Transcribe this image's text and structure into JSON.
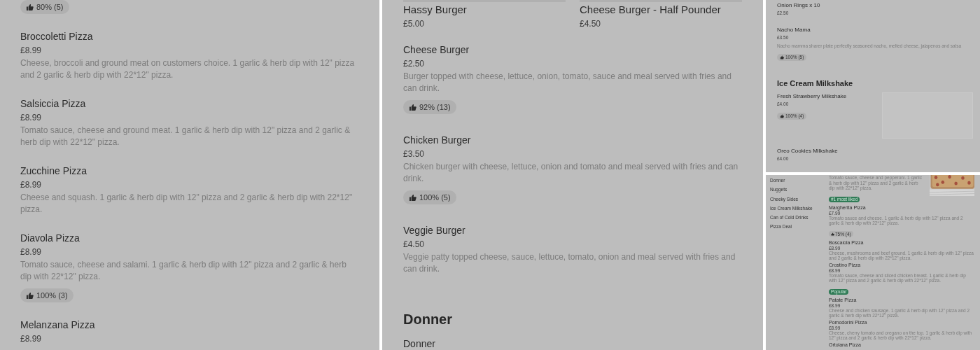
{
  "panels": [
    {
      "blocks": [
        {
          "kind": "rating",
          "text": "80% (5)"
        },
        {
          "kind": "item",
          "name": "Broccoletti Pizza",
          "price": "£8.99",
          "description": "Cheese, broccoli and ground meat on customers choice. 1 garlic & herb dip with 12\" pizza and 2 garlic & herb dip with 22*12\" pizza."
        },
        {
          "kind": "item",
          "name": "Salsiccia Pizza",
          "price": "£8.99",
          "description": "Tomato sauce, cheese and ground meat. 1 garlic & herb dip with 12\" pizza and 2 garlic & herb dip with 22*12\" pizza."
        },
        {
          "kind": "item",
          "name": "Zucchine Pizza",
          "price": "£8.99",
          "description": "Cheese and squash. 1 garlic & herb dip with 12\" pizza and 2 garlic & herb dip with 22*12\" pizza."
        },
        {
          "kind": "item",
          "name": "Diavola Pizza",
          "price": "£8.99",
          "description": "Tomato sauce, cheese and salami. 1 garlic & herb dip with 12\" pizza and 2 garlic & herb dip with 22*12\" pizza.",
          "rating": "100% (3)"
        },
        {
          "kind": "item",
          "name": "Melanzana Pizza",
          "price": "£8.99"
        }
      ]
    },
    {
      "blocks": [
        {
          "kind": "cards",
          "cards": [
            {
              "name": "Hassy Burger",
              "price": "£5.00"
            },
            {
              "name": "Cheese Burger - Half Pounder",
              "price": "£4.50"
            }
          ]
        },
        {
          "kind": "item",
          "name": "Cheese Burger",
          "price": "£2.50",
          "description": "Burger topped with cheese, lettuce, onion, tomato, sauce and meal served with fries and can drink.",
          "rating": "92% (13)"
        },
        {
          "kind": "item",
          "name": "Chicken Burger",
          "price": "£3.50",
          "description": "Chicken burger with cheese, lettuce, onion and tomato and meal served with fries and can drink.",
          "rating": "100% (5)"
        },
        {
          "kind": "item",
          "name": "Veggie Burger",
          "price": "£4.50",
          "description": "Veggie patty topped cheese, sauce, lettuce, tomato, onion and meal served with fries and can drink."
        },
        {
          "kind": "heading",
          "text": "Donner"
        },
        {
          "kind": "item",
          "name": "Donner"
        }
      ]
    },
    {
      "blocks": [
        {
          "kind": "item",
          "name": "Onion Rings x 10",
          "price": "£2.50"
        },
        {
          "kind": "item",
          "name": "Nacho Mama",
          "price": "£3.50",
          "description": "Nacho mamma sharer plate perfectly seasoned nacho, melted cheese, jalapenos and salsa",
          "rating": "100% (5)"
        },
        {
          "kind": "heading",
          "text": "Ice Cream Milkshake"
        },
        {
          "kind": "placeholder-item",
          "name": "Fresh Strawberry Milkshake",
          "price": "£4.00",
          "rating": "100% (4)"
        },
        {
          "kind": "item",
          "name": "Oreo Cookies Milkshake",
          "price": "£4.00"
        }
      ]
    },
    {
      "sidebar": {
        "items": [
          {
            "label": "Donner"
          },
          {
            "label": "Nuggets"
          },
          {
            "label": "Cheeky Sides"
          },
          {
            "label": "Ice Cream Milkshake"
          },
          {
            "label": "Can of Cold Drinks"
          },
          {
            "label": "Pizza Deal"
          }
        ]
      },
      "blocks": [
        {
          "kind": "picture-item",
          "description": "Tomato sauce, cheese and pepperoni. 1 garlic & herb dip with 12\" pizza and 2 garlic & herb dip with 22*12\" pizza.",
          "tag": "#1 most liked"
        },
        {
          "kind": "item",
          "name": "Margherita Pizza",
          "price": "£7.99",
          "description": "Tomato sauce and cheese. 1 garlic & herb dip with 12\" pizza and 2 garlic & herb dip with 22*12\" pizza.",
          "rating": "75% (4)"
        },
        {
          "kind": "item",
          "name": "Boscaiola Pizza",
          "price": "£8.99",
          "description": "Cheese, mushrooms and beef ground. 1 garlic & herb dip with 12\" pizza and 2 garlic & herb dip with 22*12\" pizza."
        },
        {
          "kind": "item",
          "name": "Crostino Pizza",
          "price": "£8.99",
          "description": "Tomato sauce, cheese and sliced chicken breast. 1 garlic & herb dip with 12\" pizza and 2 garlic & herb dip with 22*12\" pizza.",
          "tag": "Popular"
        },
        {
          "kind": "item",
          "name": "Patate Pizza",
          "price": "£8.99",
          "description": "Cheese and chicken sausage. 1 garlic & herb dip with 12\" pizza and 2 garlic & herb dip with 22*12\" pizza."
        },
        {
          "kind": "item",
          "name": "Pomodorini Pizza",
          "price": "£8.99",
          "description": "Cheese, cherry tomato and oregano on the top. 1 garlic & herb dip with 12\" pizza and 2 garlic & herb dip with 22*12\" pizza."
        },
        {
          "kind": "item",
          "name": "Ortolana Pizza"
        }
      ]
    }
  ]
}
